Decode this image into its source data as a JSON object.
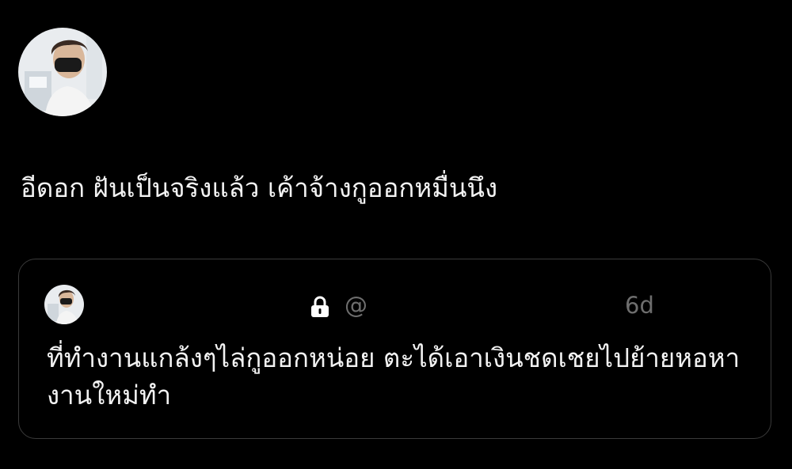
{
  "tweet": {
    "text": "อีดอก ฝันเป็นจริงแล้ว เค้าจ้างกูออกหมื่นนึง"
  },
  "quoted_tweet": {
    "handle_prefix": "@",
    "time_ago": "6d",
    "text": "ที่ทำงานแกล้งๆไล่กูออกหน่อย ตะได้เอาเงินชดเชยไปย้ายหอหางานใหม่ทำ"
  },
  "colors": {
    "background": "#000000",
    "text": "#f2f2f2",
    "muted": "#6e6e6e",
    "card_border": "#3a3a3a"
  },
  "icons": {
    "lock": "lock-icon"
  }
}
